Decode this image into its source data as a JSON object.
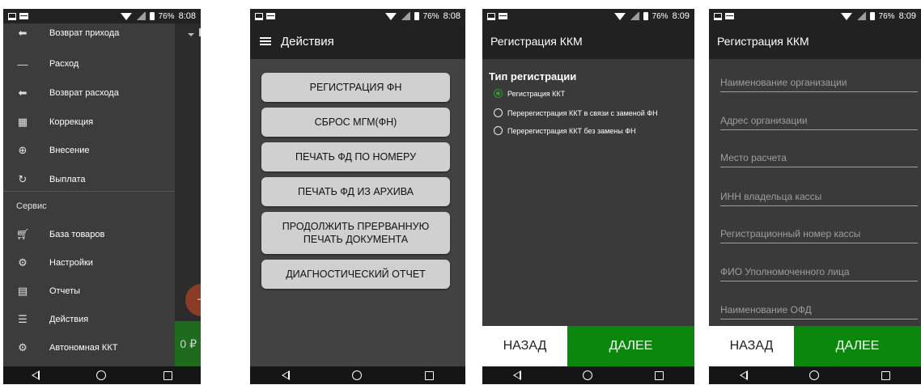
{
  "status": {
    "screen1": {
      "battery": "76%",
      "time": "8:08"
    },
    "screen2": {
      "battery": "76%",
      "time": "8:08"
    },
    "screen3": {
      "battery": "76%",
      "time": "8:09"
    },
    "screen4": {
      "battery": "76%",
      "time": "8:09"
    }
  },
  "drawer": {
    "items_top": [
      {
        "label": "Возврат прихода",
        "icon": "reply-icon"
      },
      {
        "label": "Расход",
        "icon": "minus-icon"
      },
      {
        "label": "Возврат расхода",
        "icon": "reply-icon"
      },
      {
        "label": "Коррекция",
        "icon": "calculator-icon"
      },
      {
        "label": "Внесение",
        "icon": "deposit-icon"
      },
      {
        "label": "Выплата",
        "icon": "payout-icon"
      }
    ],
    "section": "Сервис",
    "items_service": [
      {
        "label": "База товаров",
        "icon": "cart-icon"
      },
      {
        "label": "Настройки",
        "icon": "gear-icon"
      },
      {
        "label": "Отчеты",
        "icon": "report-icon"
      },
      {
        "label": "Действия",
        "icon": "clipboard-icon"
      },
      {
        "label": "Автономная ККТ",
        "icon": "gear-icon"
      }
    ],
    "background": {
      "fab": "+",
      "amount": "0 ₽"
    }
  },
  "actions": {
    "title": "Действия",
    "buttons": [
      "РЕГИСТРАЦИЯ ФН",
      "СБРОС МГМ(ФН)",
      "ПЕЧАТЬ ФД ПО НОМЕРУ",
      "ПЕЧАТЬ ФД ИЗ АРХИВА",
      "ПРОДОЛЖИТЬ ПРЕРВАННУЮ ПЕЧАТЬ ДОКУМЕНТА",
      "ДИАГНОСТИЧЕСКИЙ ОТЧЕТ"
    ]
  },
  "registration": {
    "title": "Регистрация ККМ",
    "type_title": "Тип регистрации",
    "options": [
      {
        "label": "Регистрация ККТ",
        "checked": true
      },
      {
        "label": "Перерегистрация ККТ в связи с заменой ФН",
        "checked": false
      },
      {
        "label": "Перерегистрация ККТ без замены ФН",
        "checked": false
      }
    ],
    "back": "НАЗАД",
    "next": "ДАЛЕЕ"
  },
  "registration_form": {
    "title": "Регистрация ККМ",
    "fields": [
      "Наименование организации",
      "Адрес организации",
      "Место расчета",
      "ИНН владельца кассы",
      "Регистрационный номер кассы",
      "ФИО Уполномоченного лица",
      "Наименование ОФД"
    ],
    "back": "НАЗАД",
    "next": "ДАЛЕЕ"
  },
  "colors": {
    "accent_green": "#0b870b",
    "fab": "#8a3c26"
  }
}
